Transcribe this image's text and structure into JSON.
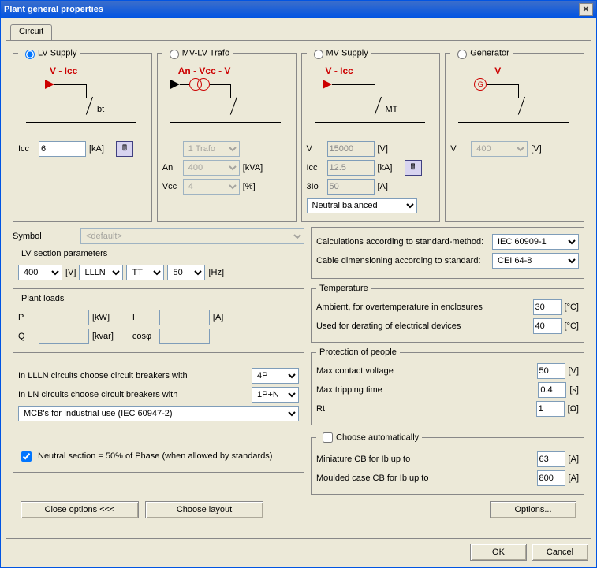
{
  "window": {
    "title": "Plant general properties"
  },
  "tab": {
    "label": "Circuit"
  },
  "supply": {
    "lv": {
      "legend": "LV Supply",
      "diag": "V - Icc",
      "node": "bt",
      "icc_label": "Icc",
      "icc_value": "6",
      "icc_unit": "[kA]"
    },
    "trafo": {
      "legend": "MV-LV Trafo",
      "diag": "An - Vcc - V",
      "count_value": "1 Trafo",
      "an_label": "An",
      "an_value": "400",
      "an_unit": "[kVA]",
      "vcc_label": "Vcc",
      "vcc_value": "4",
      "vcc_unit": "[%]"
    },
    "mv": {
      "legend": "MV Supply",
      "diag": "V - Icc",
      "node": "MT",
      "v_label": "V",
      "v_value": "15000",
      "v_unit": "[V]",
      "icc_label": "Icc",
      "icc_value": "12.5",
      "icc_unit": "[kA]",
      "i3_label": "3Io",
      "i3_value": "50",
      "i3_unit": "[A]",
      "neutral_value": "Neutral balanced"
    },
    "gen": {
      "legend": "Generator",
      "diag": "V",
      "v_label": "V",
      "v_value": "400",
      "v_unit": "[V]"
    }
  },
  "symbol": {
    "label": "Symbol",
    "value": "<default>"
  },
  "lvsec": {
    "legend": "LV section parameters",
    "volt": "400",
    "volt_unit": "[V]",
    "sys": "LLLN",
    "earth": "TT",
    "freq": "50",
    "freq_unit": "[Hz]"
  },
  "loads": {
    "legend": "Plant loads",
    "p_label": "P",
    "p_unit": "[kW]",
    "q_label": "Q",
    "q_unit": "[kvar]",
    "i_label": "I",
    "i_unit": "[A]",
    "cos_label": "cosφ"
  },
  "cbsel": {
    "lll_label": "In LLLN circuits choose circuit breakers with",
    "lll_value": "4P",
    "ln_label": "In LN circuits choose circuit breakers with",
    "ln_value": "1P+N",
    "mcb_value": "MCB's for Industrial use (IEC 60947-2)",
    "neutral50_label": "Neutral section = 50% of Phase (when allowed by standards)"
  },
  "std": {
    "calc_label": "Calculations according to standard-method:",
    "calc_value": "IEC 60909-1",
    "cable_label": "Cable dimensioning according to standard:",
    "cable_value": "CEI 64-8"
  },
  "temp": {
    "legend": "Temperature",
    "amb_label": "Ambient, for overtemperature in enclosures",
    "amb_value": "30",
    "amb_unit": "[°C]",
    "der_label": "Used for derating of electrical devices",
    "der_value": "40",
    "der_unit": "[°C]"
  },
  "prot": {
    "legend": "Protection of people",
    "mcv_label": "Max contact voltage",
    "mcv_value": "50",
    "mcv_unit": "[V]",
    "mtt_label": "Max tripping time",
    "mtt_value": "0.4",
    "mtt_unit": "[s]",
    "rt_label": "Rt",
    "rt_value": "1",
    "rt_unit": "[Ω]"
  },
  "auto": {
    "legend": "Choose automatically",
    "mcb_label": "Miniature CB for Ib up to",
    "mcb_value": "63",
    "mcb_unit": "[A]",
    "mccb_label": "Moulded case CB for Ib up to",
    "mccb_value": "800",
    "mccb_unit": "[A]"
  },
  "btns": {
    "close_opts": "Close options <<<",
    "choose_layout": "Choose layout",
    "options": "Options...",
    "ok": "OK",
    "cancel": "Cancel"
  }
}
